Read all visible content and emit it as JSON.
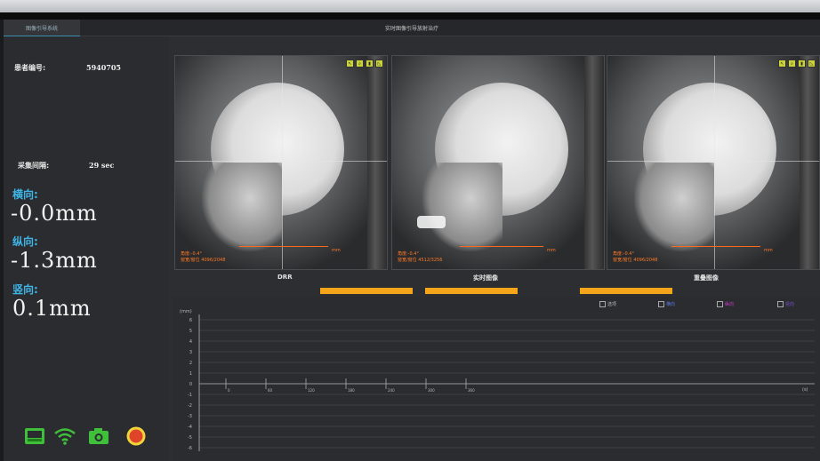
{
  "window": {
    "tab_label": "图像引导系统",
    "title": "实时图像引导放射治疗"
  },
  "patient": {
    "id_label": "患者编号:",
    "id_value": "5940705",
    "interval_label": "采集间隔:",
    "interval_value": "29 sec"
  },
  "offsets": [
    {
      "label": "横向:",
      "value": "-0.0mm"
    },
    {
      "label": "纵向:",
      "value": "-1.3mm"
    },
    {
      "label": "竖向:",
      "value": "0.1mm"
    }
  ],
  "status_icons": [
    "monitor-icon",
    "wifi-icon",
    "camera-icon",
    "record-icon"
  ],
  "images": [
    {
      "label": "DRR",
      "line1": "角度:-0.4°",
      "line2": "窗宽/窗位 4096/2048",
      "unit": "mm"
    },
    {
      "label": "实时图像",
      "line1": "角度:-0.4°",
      "line2": "窗宽/窗位 4512/3256",
      "unit": "mm"
    },
    {
      "label": "重叠图像",
      "line1": "角度:-0.4°",
      "line2": "窗宽/窗位 4096/2048",
      "unit": "mm"
    }
  ],
  "graph": {
    "legend": [
      {
        "label": "选项",
        "color": "#bbbbbb"
      },
      {
        "label": "横向",
        "color": "#5b78e6"
      },
      {
        "label": "纵向",
        "color": "#d23ad6"
      },
      {
        "label": "竖向",
        "color": "#7a4fd0"
      }
    ],
    "y_unit": "(mm)",
    "y_ticks": [
      "6",
      "5",
      "4",
      "3",
      "2",
      "1",
      "0",
      "-1",
      "-2",
      "-3",
      "-4",
      "-5",
      "-6"
    ],
    "right_label": "(s)",
    "x_ticks": [
      "0",
      "60",
      "120",
      "180",
      "240",
      "300",
      "360"
    ]
  },
  "colors": {
    "accent_blue": "#3fb6e8",
    "orange": "#f5a51a",
    "annotation": "#ff7a2a"
  }
}
